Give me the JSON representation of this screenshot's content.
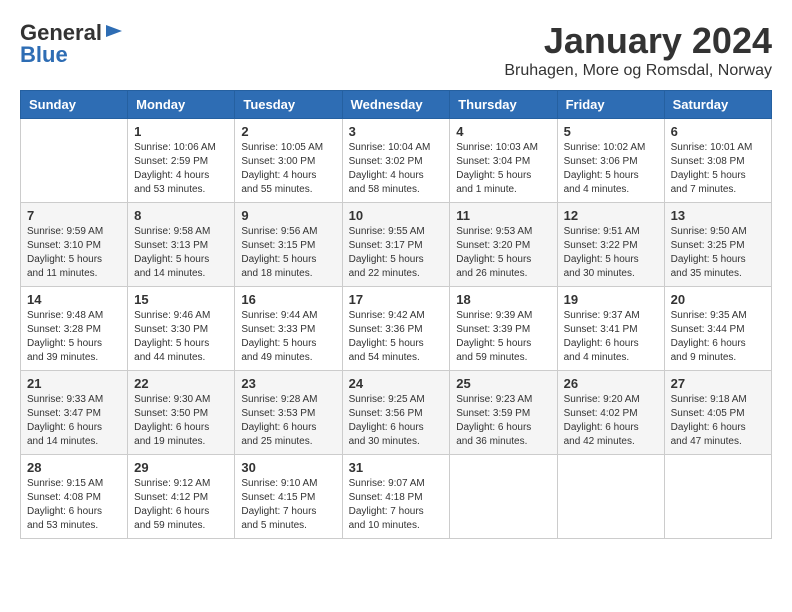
{
  "header": {
    "logo_general": "General",
    "logo_blue": "Blue",
    "month_title": "January 2024",
    "location": "Bruhagen, More og Romsdal, Norway"
  },
  "weekdays": [
    "Sunday",
    "Monday",
    "Tuesday",
    "Wednesday",
    "Thursday",
    "Friday",
    "Saturday"
  ],
  "weeks": [
    [
      {
        "day": "",
        "info": ""
      },
      {
        "day": "1",
        "info": "Sunrise: 10:06 AM\nSunset: 2:59 PM\nDaylight: 4 hours\nand 53 minutes."
      },
      {
        "day": "2",
        "info": "Sunrise: 10:05 AM\nSunset: 3:00 PM\nDaylight: 4 hours\nand 55 minutes."
      },
      {
        "day": "3",
        "info": "Sunrise: 10:04 AM\nSunset: 3:02 PM\nDaylight: 4 hours\nand 58 minutes."
      },
      {
        "day": "4",
        "info": "Sunrise: 10:03 AM\nSunset: 3:04 PM\nDaylight: 5 hours\nand 1 minute."
      },
      {
        "day": "5",
        "info": "Sunrise: 10:02 AM\nSunset: 3:06 PM\nDaylight: 5 hours\nand 4 minutes."
      },
      {
        "day": "6",
        "info": "Sunrise: 10:01 AM\nSunset: 3:08 PM\nDaylight: 5 hours\nand 7 minutes."
      }
    ],
    [
      {
        "day": "7",
        "info": "Sunrise: 9:59 AM\nSunset: 3:10 PM\nDaylight: 5 hours\nand 11 minutes."
      },
      {
        "day": "8",
        "info": "Sunrise: 9:58 AM\nSunset: 3:13 PM\nDaylight: 5 hours\nand 14 minutes."
      },
      {
        "day": "9",
        "info": "Sunrise: 9:56 AM\nSunset: 3:15 PM\nDaylight: 5 hours\nand 18 minutes."
      },
      {
        "day": "10",
        "info": "Sunrise: 9:55 AM\nSunset: 3:17 PM\nDaylight: 5 hours\nand 22 minutes."
      },
      {
        "day": "11",
        "info": "Sunrise: 9:53 AM\nSunset: 3:20 PM\nDaylight: 5 hours\nand 26 minutes."
      },
      {
        "day": "12",
        "info": "Sunrise: 9:51 AM\nSunset: 3:22 PM\nDaylight: 5 hours\nand 30 minutes."
      },
      {
        "day": "13",
        "info": "Sunrise: 9:50 AM\nSunset: 3:25 PM\nDaylight: 5 hours\nand 35 minutes."
      }
    ],
    [
      {
        "day": "14",
        "info": "Sunrise: 9:48 AM\nSunset: 3:28 PM\nDaylight: 5 hours\nand 39 minutes."
      },
      {
        "day": "15",
        "info": "Sunrise: 9:46 AM\nSunset: 3:30 PM\nDaylight: 5 hours\nand 44 minutes."
      },
      {
        "day": "16",
        "info": "Sunrise: 9:44 AM\nSunset: 3:33 PM\nDaylight: 5 hours\nand 49 minutes."
      },
      {
        "day": "17",
        "info": "Sunrise: 9:42 AM\nSunset: 3:36 PM\nDaylight: 5 hours\nand 54 minutes."
      },
      {
        "day": "18",
        "info": "Sunrise: 9:39 AM\nSunset: 3:39 PM\nDaylight: 5 hours\nand 59 minutes."
      },
      {
        "day": "19",
        "info": "Sunrise: 9:37 AM\nSunset: 3:41 PM\nDaylight: 6 hours\nand 4 minutes."
      },
      {
        "day": "20",
        "info": "Sunrise: 9:35 AM\nSunset: 3:44 PM\nDaylight: 6 hours\nand 9 minutes."
      }
    ],
    [
      {
        "day": "21",
        "info": "Sunrise: 9:33 AM\nSunset: 3:47 PM\nDaylight: 6 hours\nand 14 minutes."
      },
      {
        "day": "22",
        "info": "Sunrise: 9:30 AM\nSunset: 3:50 PM\nDaylight: 6 hours\nand 19 minutes."
      },
      {
        "day": "23",
        "info": "Sunrise: 9:28 AM\nSunset: 3:53 PM\nDaylight: 6 hours\nand 25 minutes."
      },
      {
        "day": "24",
        "info": "Sunrise: 9:25 AM\nSunset: 3:56 PM\nDaylight: 6 hours\nand 30 minutes."
      },
      {
        "day": "25",
        "info": "Sunrise: 9:23 AM\nSunset: 3:59 PM\nDaylight: 6 hours\nand 36 minutes."
      },
      {
        "day": "26",
        "info": "Sunrise: 9:20 AM\nSunset: 4:02 PM\nDaylight: 6 hours\nand 42 minutes."
      },
      {
        "day": "27",
        "info": "Sunrise: 9:18 AM\nSunset: 4:05 PM\nDaylight: 6 hours\nand 47 minutes."
      }
    ],
    [
      {
        "day": "28",
        "info": "Sunrise: 9:15 AM\nSunset: 4:08 PM\nDaylight: 6 hours\nand 53 minutes."
      },
      {
        "day": "29",
        "info": "Sunrise: 9:12 AM\nSunset: 4:12 PM\nDaylight: 6 hours\nand 59 minutes."
      },
      {
        "day": "30",
        "info": "Sunrise: 9:10 AM\nSunset: 4:15 PM\nDaylight: 7 hours\nand 5 minutes."
      },
      {
        "day": "31",
        "info": "Sunrise: 9:07 AM\nSunset: 4:18 PM\nDaylight: 7 hours\nand 10 minutes."
      },
      {
        "day": "",
        "info": ""
      },
      {
        "day": "",
        "info": ""
      },
      {
        "day": "",
        "info": ""
      }
    ]
  ]
}
